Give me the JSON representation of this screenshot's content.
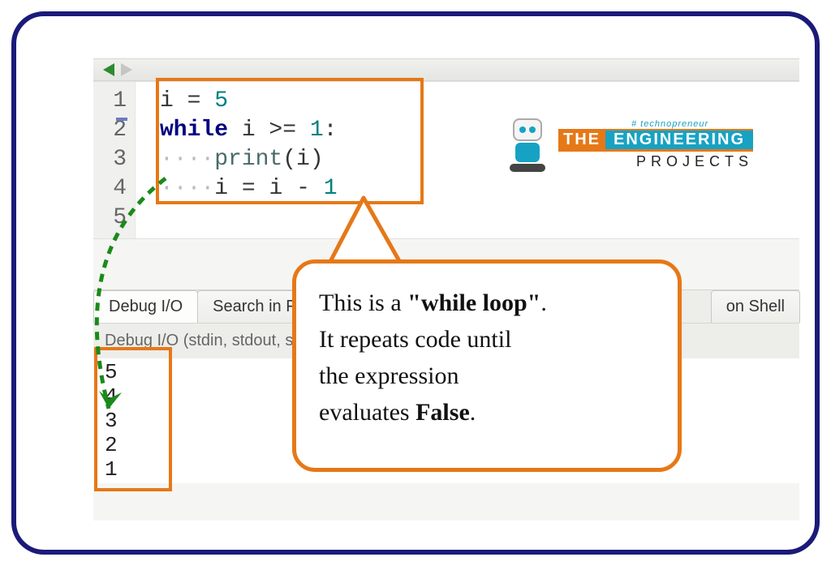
{
  "code": {
    "lines": [
      "1",
      "2",
      "3",
      "4",
      "5"
    ],
    "l1_var": "i",
    "l1_eq": " = ",
    "l1_val": "5",
    "l2_kw": "while",
    "l2_expr": " i >= ",
    "l2_val": "1",
    "l2_colon": ":",
    "dots": "····",
    "l3_fn": "print",
    "l3_open": "(",
    "l3_arg": "i",
    "l3_close": ")",
    "l4_var": "i",
    "l4_eq": " = ",
    "l4_var2": "i",
    "l4_minus": " - ",
    "l4_val": "1"
  },
  "tabs": {
    "debug": "Debug I/O",
    "search": "Search in Files",
    "shell_partial": "on Shell"
  },
  "output": {
    "header": "Debug I/O (stdin, stdout, stderr)",
    "lines": [
      "5",
      "4",
      "3",
      "2",
      "1"
    ]
  },
  "callout": {
    "p1a": "This is a ",
    "p1b": "\"while loop\"",
    "p1c": ".",
    "p2": "It repeats code until",
    "p3": "the expression",
    "p4a": "evaluates ",
    "p4b": "False",
    "p4c": "."
  },
  "logo": {
    "hash": "# technopreneur",
    "the": "THE",
    "eng": "ENGINEERING",
    "proj": "PROJECTS"
  }
}
